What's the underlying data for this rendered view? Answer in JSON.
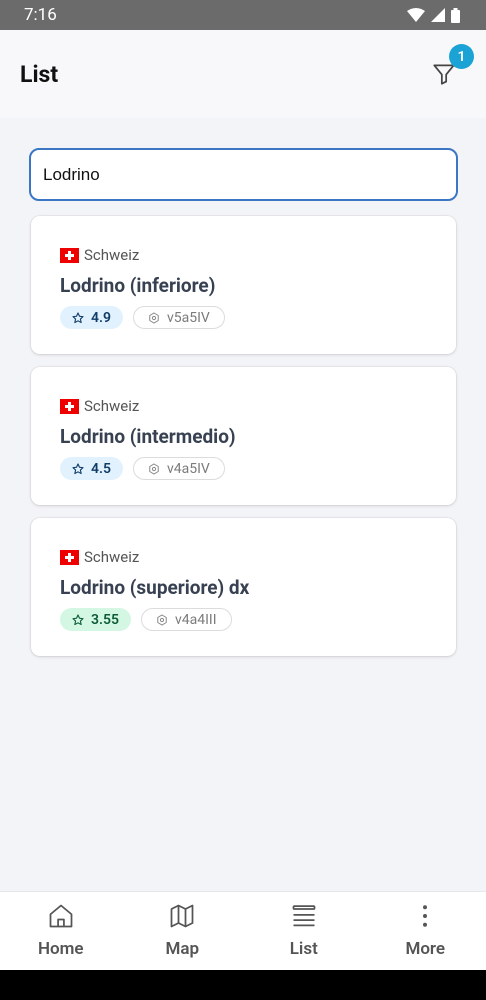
{
  "status_bar": {
    "time": "7:16"
  },
  "header": {
    "title": "List",
    "filter_count": "1"
  },
  "search": {
    "value": "Lodrino"
  },
  "results": [
    {
      "country": "Schweiz",
      "name": "Lodrino (inferiore)",
      "rating": "4.9",
      "rating_color": "blue",
      "grade": "v5a5IV"
    },
    {
      "country": "Schweiz",
      "name": "Lodrino (intermedio)",
      "rating": "4.5",
      "rating_color": "blue",
      "grade": "v4a5IV"
    },
    {
      "country": "Schweiz",
      "name": "Lodrino (superiore) dx",
      "rating": "3.55",
      "rating_color": "green",
      "grade": "v4a4III"
    }
  ],
  "bottom_nav": {
    "home": "Home",
    "map": "Map",
    "list": "List",
    "more": "More"
  },
  "colors": {
    "accent": "#1aa3d4",
    "search_border": "#3b76c5"
  }
}
